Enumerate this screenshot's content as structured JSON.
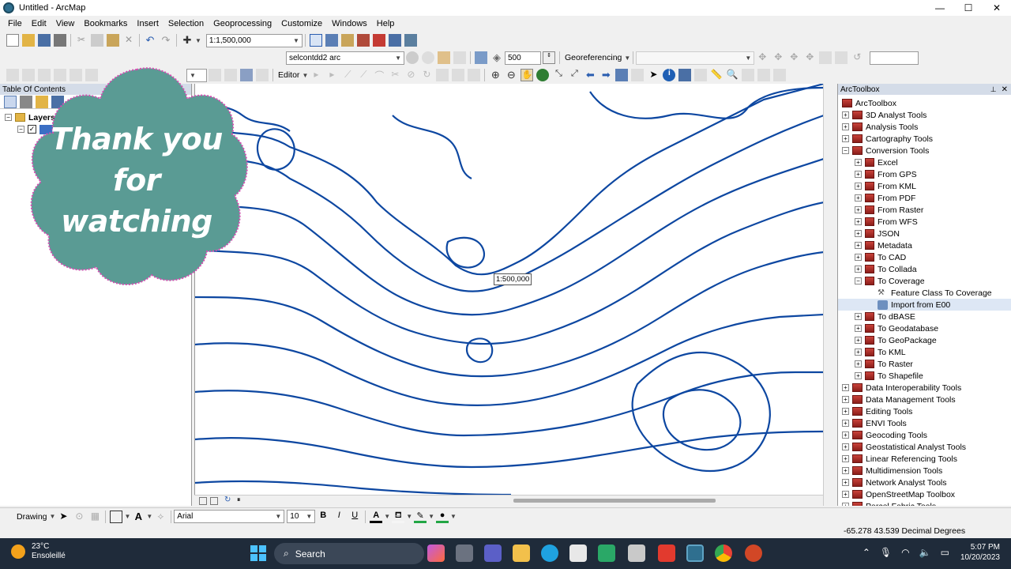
{
  "window": {
    "title": "Untitled - ArcMap",
    "minimize": "—",
    "maximize": "☐",
    "close": "✕"
  },
  "menu": [
    "File",
    "Edit",
    "View",
    "Bookmarks",
    "Insert",
    "Selection",
    "Geoprocessing",
    "Customize",
    "Windows",
    "Help"
  ],
  "standard_toolbar": {
    "scale": "1:1,500,000"
  },
  "layer_toolbar": {
    "layer": "selcontdd2 arc",
    "value": "500",
    "georeferencing_label": "Georeferencing"
  },
  "editor_toolbar": {
    "editor_label": "Editor"
  },
  "toc": {
    "title": "Table Of Contents",
    "layers_label": "Layers"
  },
  "map": {
    "scale_tip": "1:500,000",
    "contour_color": "#0d47a1"
  },
  "arctoolbox": {
    "title": "ArcToolbox",
    "pin": "📌",
    "close": "✕",
    "root": "ArcToolbox",
    "items": [
      {
        "label": "3D Analyst Tools",
        "level": 1,
        "expander": "+",
        "icon": "toolbox"
      },
      {
        "label": "Analysis Tools",
        "level": 1,
        "expander": "+",
        "icon": "toolbox"
      },
      {
        "label": "Cartography Tools",
        "level": 1,
        "expander": "+",
        "icon": "toolbox"
      },
      {
        "label": "Conversion Tools",
        "level": 1,
        "expander": "−",
        "icon": "toolbox"
      },
      {
        "label": "Excel",
        "level": 2,
        "expander": "+",
        "icon": "toolset"
      },
      {
        "label": "From GPS",
        "level": 2,
        "expander": "+",
        "icon": "toolset"
      },
      {
        "label": "From KML",
        "level": 2,
        "expander": "+",
        "icon": "toolset"
      },
      {
        "label": "From PDF",
        "level": 2,
        "expander": "+",
        "icon": "toolset"
      },
      {
        "label": "From Raster",
        "level": 2,
        "expander": "+",
        "icon": "toolset"
      },
      {
        "label": "From WFS",
        "level": 2,
        "expander": "+",
        "icon": "toolset"
      },
      {
        "label": "JSON",
        "level": 2,
        "expander": "+",
        "icon": "toolset"
      },
      {
        "label": "Metadata",
        "level": 2,
        "expander": "+",
        "icon": "toolset"
      },
      {
        "label": "To CAD",
        "level": 2,
        "expander": "+",
        "icon": "toolset"
      },
      {
        "label": "To Collada",
        "level": 2,
        "expander": "+",
        "icon": "toolset"
      },
      {
        "label": "To Coverage",
        "level": 2,
        "expander": "−",
        "icon": "toolset"
      },
      {
        "label": "Feature Class To Coverage",
        "level": 3,
        "expander": "",
        "icon": "hammer"
      },
      {
        "label": "Import from E00",
        "level": 3,
        "expander": "",
        "icon": "script"
      },
      {
        "label": "To dBASE",
        "level": 2,
        "expander": "+",
        "icon": "toolset"
      },
      {
        "label": "To Geodatabase",
        "level": 2,
        "expander": "+",
        "icon": "toolset"
      },
      {
        "label": "To GeoPackage",
        "level": 2,
        "expander": "+",
        "icon": "toolset"
      },
      {
        "label": "To KML",
        "level": 2,
        "expander": "+",
        "icon": "toolset"
      },
      {
        "label": "To Raster",
        "level": 2,
        "expander": "+",
        "icon": "toolset"
      },
      {
        "label": "To Shapefile",
        "level": 2,
        "expander": "+",
        "icon": "toolset"
      },
      {
        "label": "Data Interoperability Tools",
        "level": 1,
        "expander": "+",
        "icon": "toolbox"
      },
      {
        "label": "Data Management Tools",
        "level": 1,
        "expander": "+",
        "icon": "toolbox"
      },
      {
        "label": "Editing Tools",
        "level": 1,
        "expander": "+",
        "icon": "toolbox"
      },
      {
        "label": "ENVI Tools",
        "level": 1,
        "expander": "+",
        "icon": "toolbox"
      },
      {
        "label": "Geocoding Tools",
        "level": 1,
        "expander": "+",
        "icon": "toolbox"
      },
      {
        "label": "Geostatistical Analyst Tools",
        "level": 1,
        "expander": "+",
        "icon": "toolbox"
      },
      {
        "label": "Linear Referencing Tools",
        "level": 1,
        "expander": "+",
        "icon": "toolbox"
      },
      {
        "label": "Multidimension Tools",
        "level": 1,
        "expander": "+",
        "icon": "toolbox"
      },
      {
        "label": "Network Analyst Tools",
        "level": 1,
        "expander": "+",
        "icon": "toolbox"
      },
      {
        "label": "OpenStreetMap Toolbox",
        "level": 1,
        "expander": "+",
        "icon": "toolbox"
      },
      {
        "label": "Parcel Fabric Tools",
        "level": 1,
        "expander": "+",
        "icon": "toolbox"
      }
    ]
  },
  "drawing_toolbar": {
    "drawing_label": "Drawing",
    "font": "Arial",
    "font_size": "10",
    "bold": "B",
    "italic": "I",
    "underline": "U",
    "font_color_letter": "A"
  },
  "status": {
    "coordinates": "-65.278  43.539 Decimal Degrees"
  },
  "taskbar": {
    "temperature": "23°C",
    "weather": "Ensoleillé",
    "search": "Search",
    "time": "5:07 PM",
    "date": "10/20/2023"
  },
  "overlay": {
    "line1": "Thank you",
    "line2": "for",
    "line3": "watching",
    "fill": "#5a9b94",
    "border": "#d24fb0"
  }
}
